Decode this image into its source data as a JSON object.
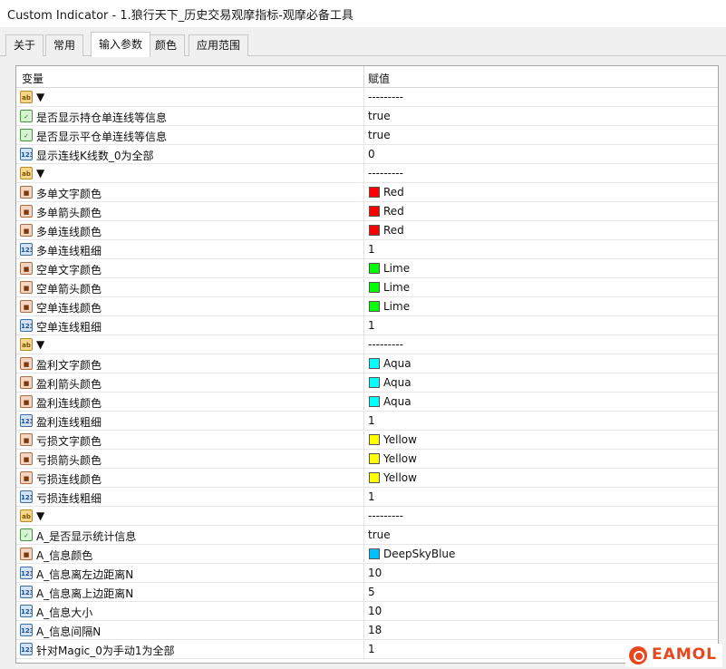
{
  "window": {
    "title": "Custom Indicator - 1.狼行天下_历史交易观摩指标-观摩必备工具"
  },
  "tabs": [
    {
      "label": "关于",
      "active": false
    },
    {
      "label": "常用",
      "active": false
    },
    {
      "label": "输入参数",
      "active": true
    },
    {
      "label": "颜色",
      "active": false
    },
    {
      "label": "应用范围",
      "active": false
    }
  ],
  "grid": {
    "header": {
      "variable": "变量",
      "value": "赋值"
    },
    "rows": [
      {
        "icon": "string-icon",
        "variable": "▼",
        "value": "---------"
      },
      {
        "icon": "bool-icon",
        "variable": "是否显示持仓单连线等信息",
        "value": "true"
      },
      {
        "icon": "bool-icon",
        "variable": "是否显示平仓单连线等信息",
        "value": "true"
      },
      {
        "icon": "int-icon",
        "variable": "显示连线K线数_0为全部",
        "value": "0"
      },
      {
        "icon": "string-icon",
        "variable": "▼",
        "value": "---------"
      },
      {
        "icon": "color-icon",
        "variable": "多单文字颜色",
        "value": "Red",
        "swatch": "#ff0000"
      },
      {
        "icon": "color-icon",
        "variable": "多单箭头颜色",
        "value": "Red",
        "swatch": "#ff0000"
      },
      {
        "icon": "color-icon",
        "variable": "多单连线颜色",
        "value": "Red",
        "swatch": "#ff0000"
      },
      {
        "icon": "int-icon",
        "variable": "多单连线粗细",
        "value": "1"
      },
      {
        "icon": "color-icon",
        "variable": "空单文字颜色",
        "value": "Lime",
        "swatch": "#00ff00"
      },
      {
        "icon": "color-icon",
        "variable": "空单箭头颜色",
        "value": "Lime",
        "swatch": "#00ff00"
      },
      {
        "icon": "color-icon",
        "variable": "空单连线颜色",
        "value": "Lime",
        "swatch": "#00ff00"
      },
      {
        "icon": "int-icon",
        "variable": "空单连线粗细",
        "value": "1"
      },
      {
        "icon": "string-icon",
        "variable": "▼",
        "value": "---------"
      },
      {
        "icon": "color-icon",
        "variable": "盈利文字颜色",
        "value": "Aqua",
        "swatch": "#00ffff"
      },
      {
        "icon": "color-icon",
        "variable": "盈利箭头颜色",
        "value": "Aqua",
        "swatch": "#00ffff"
      },
      {
        "icon": "color-icon",
        "variable": "盈利连线颜色",
        "value": "Aqua",
        "swatch": "#00ffff"
      },
      {
        "icon": "int-icon",
        "variable": "盈利连线粗细",
        "value": "1"
      },
      {
        "icon": "color-icon",
        "variable": "亏损文字颜色",
        "value": "Yellow",
        "swatch": "#ffff00"
      },
      {
        "icon": "color-icon",
        "variable": "亏损箭头颜色",
        "value": "Yellow",
        "swatch": "#ffff00"
      },
      {
        "icon": "color-icon",
        "variable": "亏损连线颜色",
        "value": "Yellow",
        "swatch": "#ffff00"
      },
      {
        "icon": "int-icon",
        "variable": "亏损连线粗细",
        "value": "1"
      },
      {
        "icon": "string-icon",
        "variable": "▼",
        "value": "---------"
      },
      {
        "icon": "bool-icon",
        "variable": "A_是否显示统计信息",
        "value": "true"
      },
      {
        "icon": "color-icon",
        "variable": "A_信息颜色",
        "value": "DeepSkyBlue",
        "swatch": "#00bfff"
      },
      {
        "icon": "int-icon",
        "variable": "A_信息离左边距离N",
        "value": "10"
      },
      {
        "icon": "int-icon",
        "variable": "A_信息离上边距离N",
        "value": "5"
      },
      {
        "icon": "int-icon",
        "variable": "A_信息大小",
        "value": "10"
      },
      {
        "icon": "int-icon",
        "variable": "A_信息间隔N",
        "value": "18"
      },
      {
        "icon": "int-icon",
        "variable": "针对Magic_0为手动1为全部",
        "value": "1"
      }
    ]
  },
  "icon_glyphs": {
    "string-icon": "ab",
    "bool-icon": "✓",
    "int-icon": "123",
    "color-icon": "■"
  },
  "watermark": {
    "text": "EAMOL",
    "color": "#e8471c"
  }
}
